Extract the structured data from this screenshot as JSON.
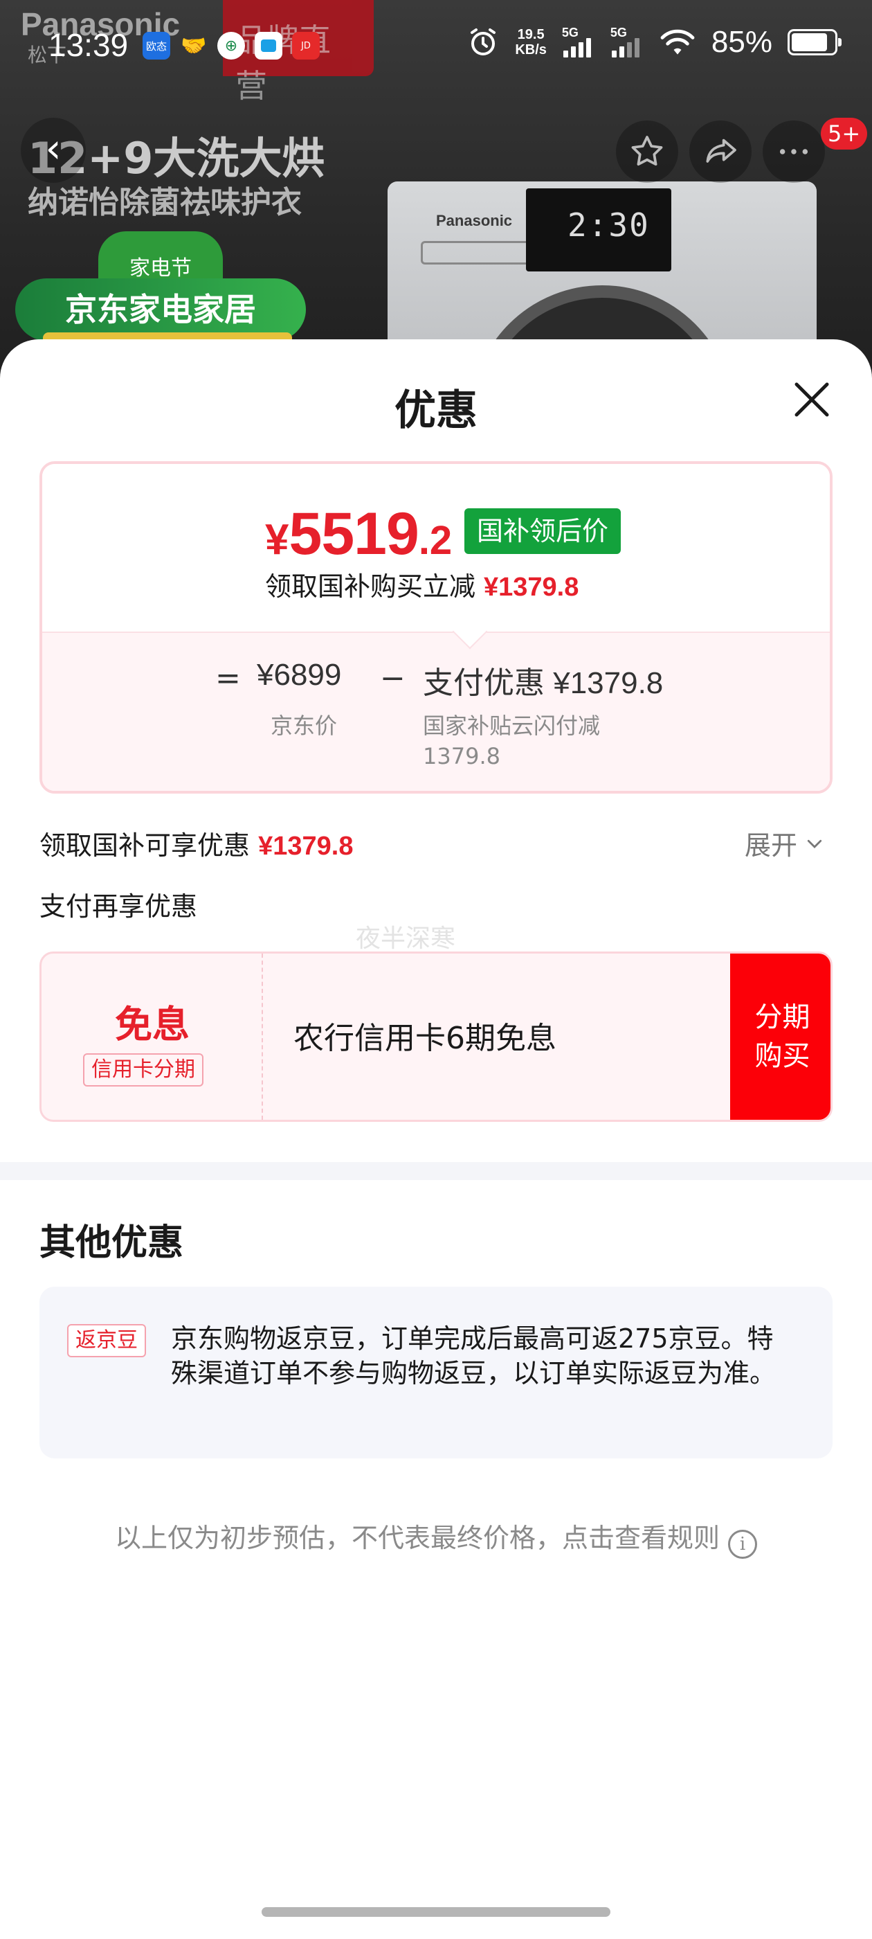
{
  "status_bar": {
    "time": "13:39",
    "app_icons": [
      "欧态",
      "handshake",
      "bank",
      "cloud",
      "JD"
    ],
    "net_speed_value": "19.5",
    "net_speed_unit": "KB/s",
    "signal1_label": "5G",
    "signal2_label": "5G",
    "battery": "85%",
    "battery_level": 0.85
  },
  "background": {
    "brand": "Panasonic",
    "brand_sub": "松下",
    "store_tag": "品牌直营",
    "headline": "12+9大洗大烘",
    "subline": "纳诺怡除菌祛味护衣",
    "promo_badge": "家电节",
    "promo_title": "京东家电家居",
    "notif_count": "5+",
    "washer_brand": "Panasonic",
    "washer_time": "2:30"
  },
  "sheet": {
    "title": "优惠",
    "final_price": {
      "symbol": "¥",
      "integer": "5519",
      "decimal": ".2",
      "tag": "国补领后价"
    },
    "claim_text": "领取国补购买立减",
    "claim_amount": "¥1379.8",
    "calc": {
      "eq": "=",
      "jd_price": "¥6899",
      "jd_price_label": "京东价",
      "minus": "−",
      "pay_discount": "支付优惠 ¥1379.8",
      "pay_discount_line1": "国家补贴云闪付减",
      "pay_discount_line2": "1379.8"
    },
    "gov_subsidy_label": "领取国补可享优惠",
    "gov_subsidy_amount": "¥1379.8",
    "expand_label": "展开",
    "pay_more_label": "支付再享优惠",
    "watermark": "夜半深寒",
    "installment": {
      "free_label": "免息",
      "cc_tag": "信用卡分期",
      "desc": "农行信用卡6期免息",
      "button_line1": "分期",
      "button_line2": "购买"
    },
    "other_title": "其他优惠",
    "other_card": {
      "tag": "返京豆",
      "text": "京东购物返京豆，订单完成后最高可返275京豆。特殊渠道订单不参与购物返豆，以订单实际返豆为准。"
    },
    "footnote": "以上仅为初步预估，不代表最终价格，点击查看规则",
    "footnote_icon": "i"
  },
  "colors": {
    "accent_red": "#e6202b",
    "button_red": "#fc0008",
    "tag_green": "#13a23c",
    "card_pink_bg": "#fff4f6"
  }
}
